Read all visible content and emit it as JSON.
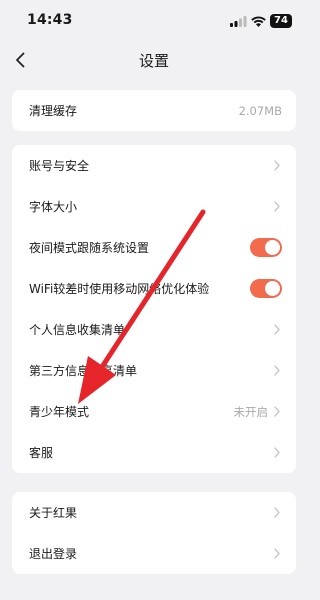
{
  "status_bar": {
    "time": "14:43",
    "battery": "74"
  },
  "nav": {
    "title": "设置"
  },
  "cache": {
    "label": "清理缓存",
    "value": "2.07MB"
  },
  "settings": {
    "account_security": "账号与安全",
    "font_size": "字体大小",
    "night_mode_follow_system": "夜间模式跟随系统设置",
    "wifi_mobile_optimization": "WiFi较差时使用移动网络优化体验",
    "personal_info_list": "个人信息收集清单",
    "third_party_info_list": "第三方信息共享清单",
    "teen_mode": "青少年模式",
    "teen_mode_status": "未开启",
    "customer_service": "客服"
  },
  "toggles": {
    "night_mode_on": true,
    "wifi_optimization_on": true
  },
  "about": {
    "about_label": "关于红果",
    "logout_label": "退出登录"
  },
  "colors": {
    "accent": "#f26b4d",
    "arrow": "#e5252a",
    "background": "#f1f1f3"
  },
  "icons": [
    "signal-icon",
    "wifi-icon",
    "battery-icon",
    "back-icon",
    "chevron-right-icon"
  ]
}
